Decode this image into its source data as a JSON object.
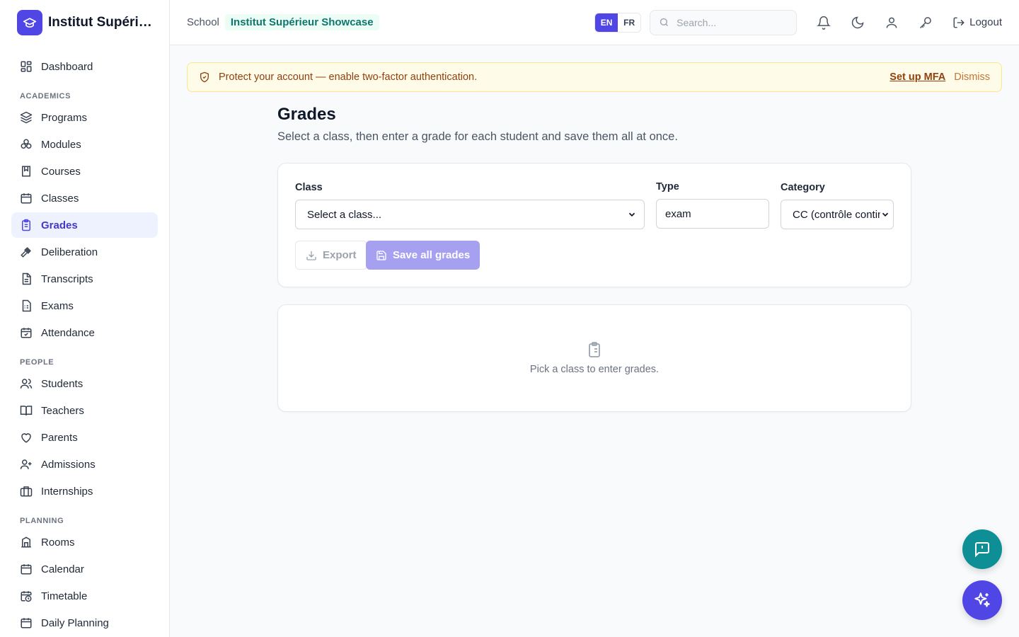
{
  "brand": {
    "name": "Institut Supérieur Showcase",
    "logo_icon": "graduation-cap-icon",
    "accent": "#4f46e5"
  },
  "sidebar": {
    "top": [
      {
        "label": "Dashboard",
        "icon": "dashboard-icon"
      }
    ],
    "sections": [
      {
        "title": "ACADEMICS",
        "items": [
          {
            "label": "Programs",
            "icon": "layers-icon"
          },
          {
            "label": "Modules",
            "icon": "modules-icon"
          },
          {
            "label": "Courses",
            "icon": "book-icon"
          },
          {
            "label": "Classes",
            "icon": "calendar-icon"
          },
          {
            "label": "Grades",
            "icon": "clipboard-icon",
            "active": true
          },
          {
            "label": "Deliberation",
            "icon": "gavel-icon"
          },
          {
            "label": "Transcripts",
            "icon": "file-text-icon"
          },
          {
            "label": "Exams",
            "icon": "file-list-icon"
          },
          {
            "label": "Attendance",
            "icon": "calendar-check-icon"
          }
        ]
      },
      {
        "title": "PEOPLE",
        "items": [
          {
            "label": "Students",
            "icon": "users-icon"
          },
          {
            "label": "Teachers",
            "icon": "book-open-icon"
          },
          {
            "label": "Parents",
            "icon": "heart-icon"
          },
          {
            "label": "Admissions",
            "icon": "user-plus-icon"
          },
          {
            "label": "Internships",
            "icon": "briefcase-icon"
          }
        ]
      },
      {
        "title": "PLANNING",
        "items": [
          {
            "label": "Rooms",
            "icon": "building-icon"
          },
          {
            "label": "Calendar",
            "icon": "calendar-days-icon"
          },
          {
            "label": "Timetable",
            "icon": "calendar-clock-icon"
          },
          {
            "label": "Daily Planning",
            "icon": "calendar-icon"
          }
        ]
      }
    ]
  },
  "topbar": {
    "crumb_label": "School",
    "crumb_value": "Institut Supérieur Showcase",
    "lang": {
      "en": "EN",
      "fr": "FR",
      "selected": "EN"
    },
    "search_placeholder": "Search...",
    "logout": "Logout"
  },
  "banner": {
    "text": "Protect your account — enable two-factor authentication.",
    "action": "Set up MFA",
    "dismiss": "Dismiss"
  },
  "page": {
    "title": "Grades",
    "subtitle": "Select a class, then enter a grade for each student and save them all at once."
  },
  "filters": {
    "class_label": "Class",
    "class_value": "Select a class...",
    "type_label": "Type",
    "type_value": "exam",
    "category_label": "Category",
    "category_value": "CC (contrôle continu)",
    "export": "Export",
    "save": "Save all grades"
  },
  "empty": {
    "text": "Pick a class to enter grades."
  }
}
